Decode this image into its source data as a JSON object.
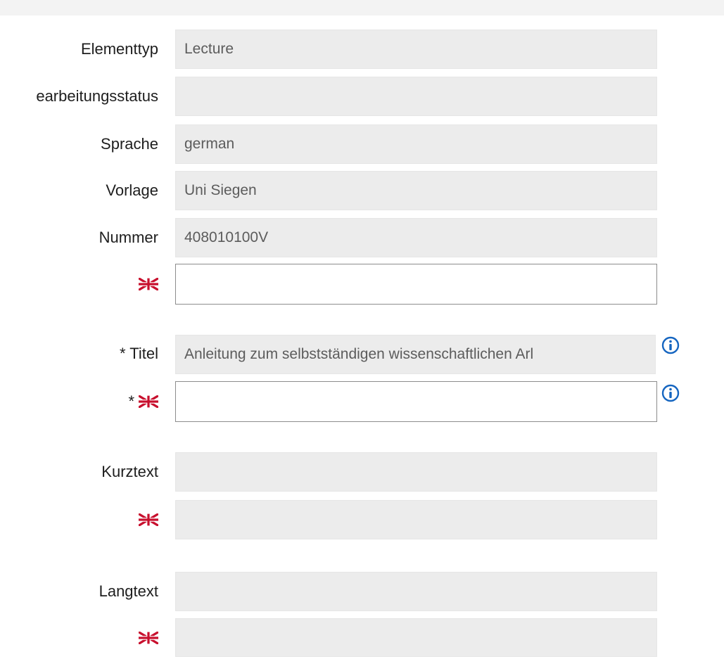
{
  "fields": {
    "elementtyp": {
      "label": "Elementtyp",
      "value": "Lecture"
    },
    "bearbeitungsstatus": {
      "label": "earbeitungsstatus",
      "value": ""
    },
    "sprache": {
      "label": "Sprache",
      "value": "german"
    },
    "vorlage": {
      "label": "Vorlage",
      "value": "Uni Siegen"
    },
    "nummer": {
      "label": "Nummer",
      "value": "408010100V"
    },
    "nummer_en": {
      "value": ""
    },
    "titel": {
      "label": "* Titel",
      "value": "Anleitung zum selbstständigen wissenschaftlichen Arl"
    },
    "titel_en": {
      "required_mark": "*",
      "value": ""
    },
    "kurztext": {
      "label": "Kurztext",
      "value": ""
    },
    "kurztext_en": {
      "value": ""
    },
    "langtext": {
      "label": "Langtext",
      "value": ""
    },
    "langtext_en": {
      "value": ""
    }
  },
  "icons": {
    "flag": "uk-flag-icon",
    "info": "info-circle-icon"
  },
  "colors": {
    "readonly_bg": "#ececec",
    "info_blue": "#1565c0"
  }
}
